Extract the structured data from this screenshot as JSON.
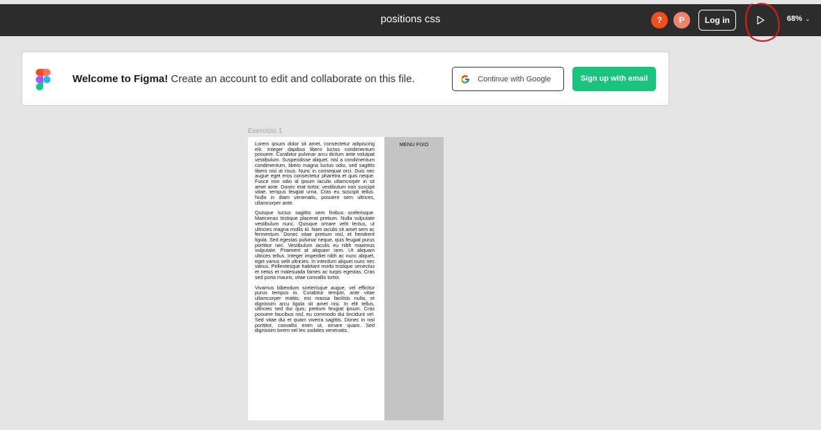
{
  "topbar": {
    "title": "positions css",
    "help_avatar": "?",
    "user_avatar": "P",
    "login_label": "Log in",
    "zoom": "68%",
    "colors": {
      "bar": "#2c2c2c",
      "help": "#f24e1e",
      "user": "#f0836c"
    }
  },
  "banner": {
    "welcome_bold": "Welcome to Figma!",
    "welcome_rest": " Create an account to edit and collaborate on this file.",
    "google_label": "Continue with Google",
    "email_label": "Sign up with email",
    "accent": "#1bc47d"
  },
  "frame": {
    "label": "Exercício 1",
    "menu_label": "MENU FIXO",
    "paragraphs": [
      "Lorem ipsum dolor sit amet, consectetur adipiscing elit. Integer dapibus libero luctus condimentum posuere. Curabitur pulvinar arcu dictum ante volutpat vestibulum. Suspendisse aliquet, nisl a condimentum condimentum, libero magna luctus odio, sed sagittis libero nisi at risus. Nunc in consequat orci. Duis nec augue eget eros consectetur pharetra et quis neque. Fusce non odio id ipsum iaculis ullamcorper in sit amet ante. Donec erat tortor, vestibulum non suscipit vitae, tempus feugiat urna. Cras eu suscipit tellus. Nulla in diam venenatis, posuere sem ultrices, ullamcorper ante.",
      "Quisque luctus sagittis sem finibus scelerisque. Maecenas tristique placerat pretium. Nulla vulputate vestibulum nunc. Quisque ornare velit lectus, ut ultricies magna mollis id. Nam iaculis sit amet sem ac fermentum. Donec vitae pretium nisl, et hendrerit ligula. Sed egestas pulvinar neque, quis feugiat purus porttitor nec. Vestibulum iaculis eu nibh maximus vulputate. Praesent at aliquam sem. Ut aliquam ultrices tellus. Integer imperdiet nibh ac nunc aliquet, eget varius velit ultricies. In interdum aliquet nunc nec varius. Pellentesque habitant morbi tristique senectus et netus et malesuada fames ac turpis egestas. Cras sed porta mauris, vitae convallis tortor.",
      "Vivamus bibendum scelerisque augue, vel efficitur purus tempus in. Curabitur tempor, ante vitae ullamcorper mattis, est massa facilisis nulla, et dignissim arcu ligula sit amet nisi. In elit tellus, ultricies sed dui quis, pretium feugiat ipsum. Cras posuere faucibus nisl, eu commodo dui tincidunt vel. Sed vitae dui et quam viverra sagittis. Donec in nisl porttitor, convallis enim ut, ornare quam. Sed dignissim lorem vel leo sodales venenatis."
    ]
  },
  "icons": {
    "play": "play-icon",
    "chevron": "chevron-down-icon",
    "figma": "figma-logo-icon",
    "google": "google-icon"
  }
}
